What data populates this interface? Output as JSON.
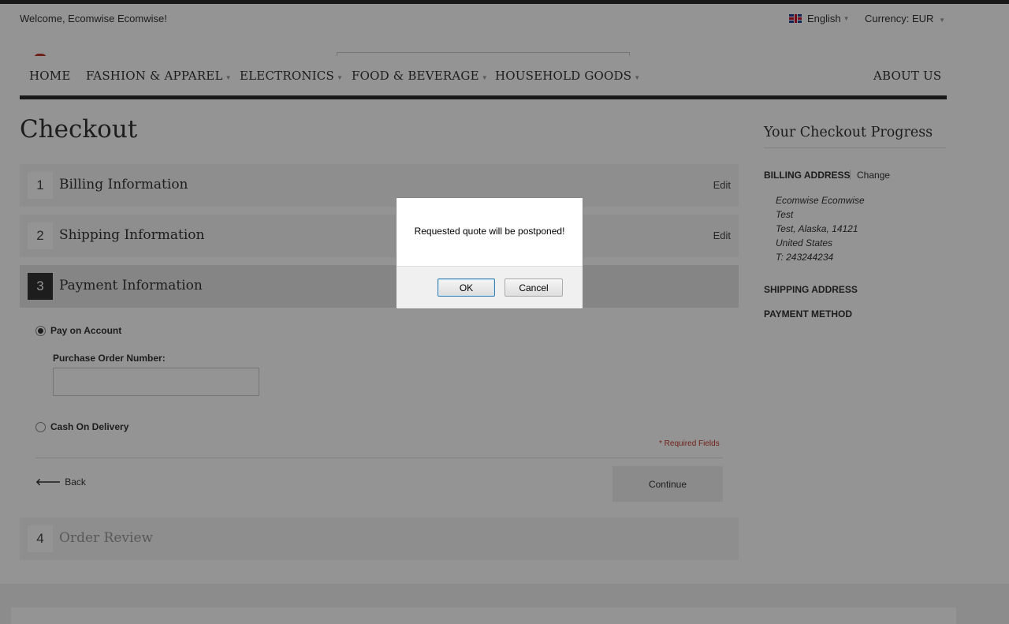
{
  "header": {
    "welcome": "Welcome, Ecomwise Ecomwise!",
    "language": "English",
    "currency_label": "Currency:",
    "currency_value": "EUR"
  },
  "nav": {
    "items": [
      "HOME",
      "FASHION & APPAREL",
      "ELECTRONICS",
      "FOOD & BEVERAGE",
      "HOUSEHOLD GOODS",
      "ABOUT US"
    ]
  },
  "page": {
    "title": "Checkout"
  },
  "steps": [
    {
      "num": "1",
      "title": "Billing Information",
      "edit": "Edit"
    },
    {
      "num": "2",
      "title": "Shipping Information",
      "edit": "Edit"
    },
    {
      "num": "3",
      "title": "Payment Information"
    },
    {
      "num": "4",
      "title": "Order Review"
    }
  ],
  "payment": {
    "option1": "Pay on Account",
    "po_label": "Purchase Order Number:",
    "po_value": "",
    "option2": "Cash On Delivery",
    "required": "* Required Fields",
    "back": "Back",
    "continue": "Continue"
  },
  "sidebar": {
    "title": "Your Checkout Progress",
    "billing_head": "BILLING ADDRESS",
    "change": "Change",
    "address": [
      "Ecomwise Ecomwise",
      "Test",
      "Test, Alaska, 14121",
      "United States",
      "T: 243244234"
    ],
    "shipping_head": "SHIPPING ADDRESS",
    "payment_head": "PAYMENT METHOD"
  },
  "dialog": {
    "message": "Requested quote will be postponed!",
    "ok": "OK",
    "cancel": "Cancel"
  }
}
